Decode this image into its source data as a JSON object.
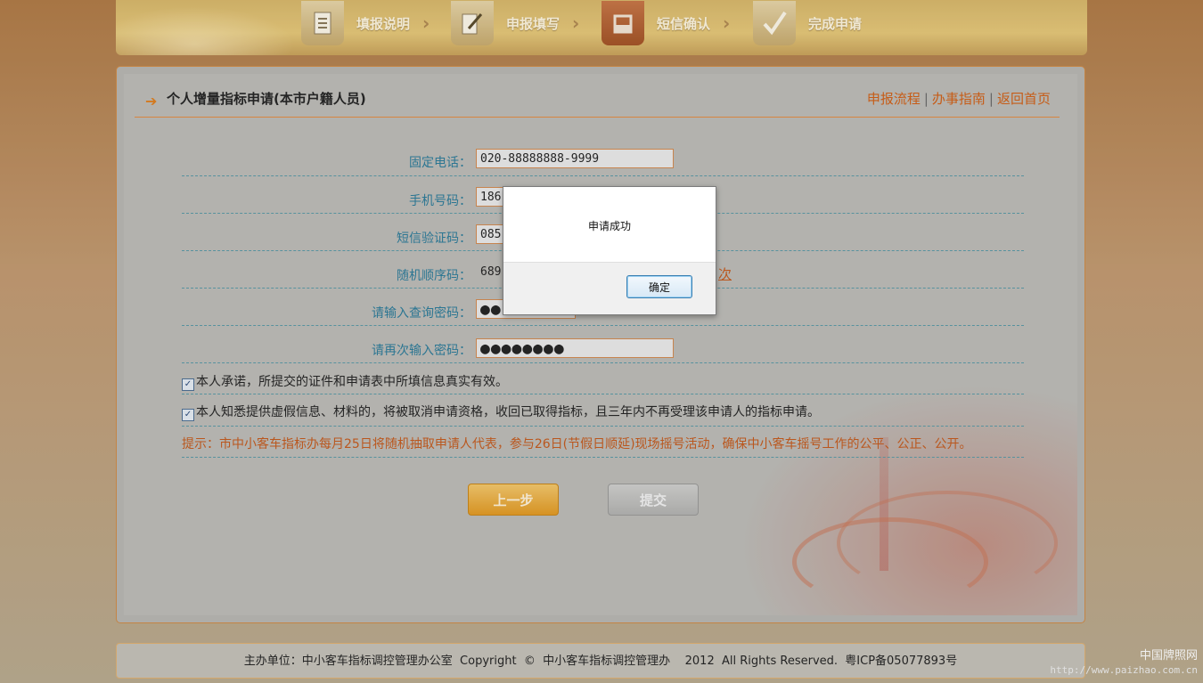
{
  "steps": [
    {
      "label": "填报说明",
      "icon": "document-icon"
    },
    {
      "label": "申报填写",
      "icon": "edit-icon"
    },
    {
      "label": "短信确认",
      "icon": "phone-icon"
    },
    {
      "label": "完成申请",
      "icon": "check-icon"
    }
  ],
  "header": {
    "title": "个人增量指标申请(本市户籍人员)",
    "links": [
      "申报流程",
      "办事指南",
      "返回首页"
    ],
    "link_separator": "|"
  },
  "form": {
    "landline": {
      "label": "固定电话：",
      "value": "020-88888888-9999"
    },
    "mobile": {
      "label": "手机号码：",
      "value": "186"
    },
    "sms_code": {
      "label": "短信验证码：",
      "value": "085"
    },
    "random_seq": {
      "label": "随机顺序码：",
      "value": "689",
      "link_fragment": "次"
    },
    "query_pw": {
      "label": "请输入查询密码：",
      "value": "●●"
    },
    "query_pw_confirm": {
      "label": "请再次输入密码：",
      "value": "●●●●●●●●"
    },
    "pledge1": "本人承诺，所提交的证件和申请表中所填信息真实有效。",
    "pledge2": "本人知悉提供虚假信息、材料的，将被取消申请资格，收回已取得指标，且三年内不再受理该申请人的指标申请。",
    "tip": "提示：市中小客车指标办每月25日将随机抽取申请人代表，参与26日(节假日顺延)现场摇号活动，确保中小客车摇号工作的公平、公正、公开。"
  },
  "buttons": {
    "prev": "上一步",
    "submit": "提交"
  },
  "footer": {
    "text": "主办单位：中小客车指标调控管理办公室  Copyright  ©  中小客车指标调控管理办    2012  All Rights Reserved.  粤ICP备05077893号"
  },
  "watermark": {
    "line1": "中国牌照网",
    "line2": "http://www.paizhao.com.cn"
  },
  "dialog": {
    "message": "申请成功",
    "ok_label": "确定"
  },
  "colors": {
    "accent": "#d25f14",
    "label": "#2b7b9a",
    "tip": "#c55a1c",
    "active_step": "#b35e2c"
  }
}
